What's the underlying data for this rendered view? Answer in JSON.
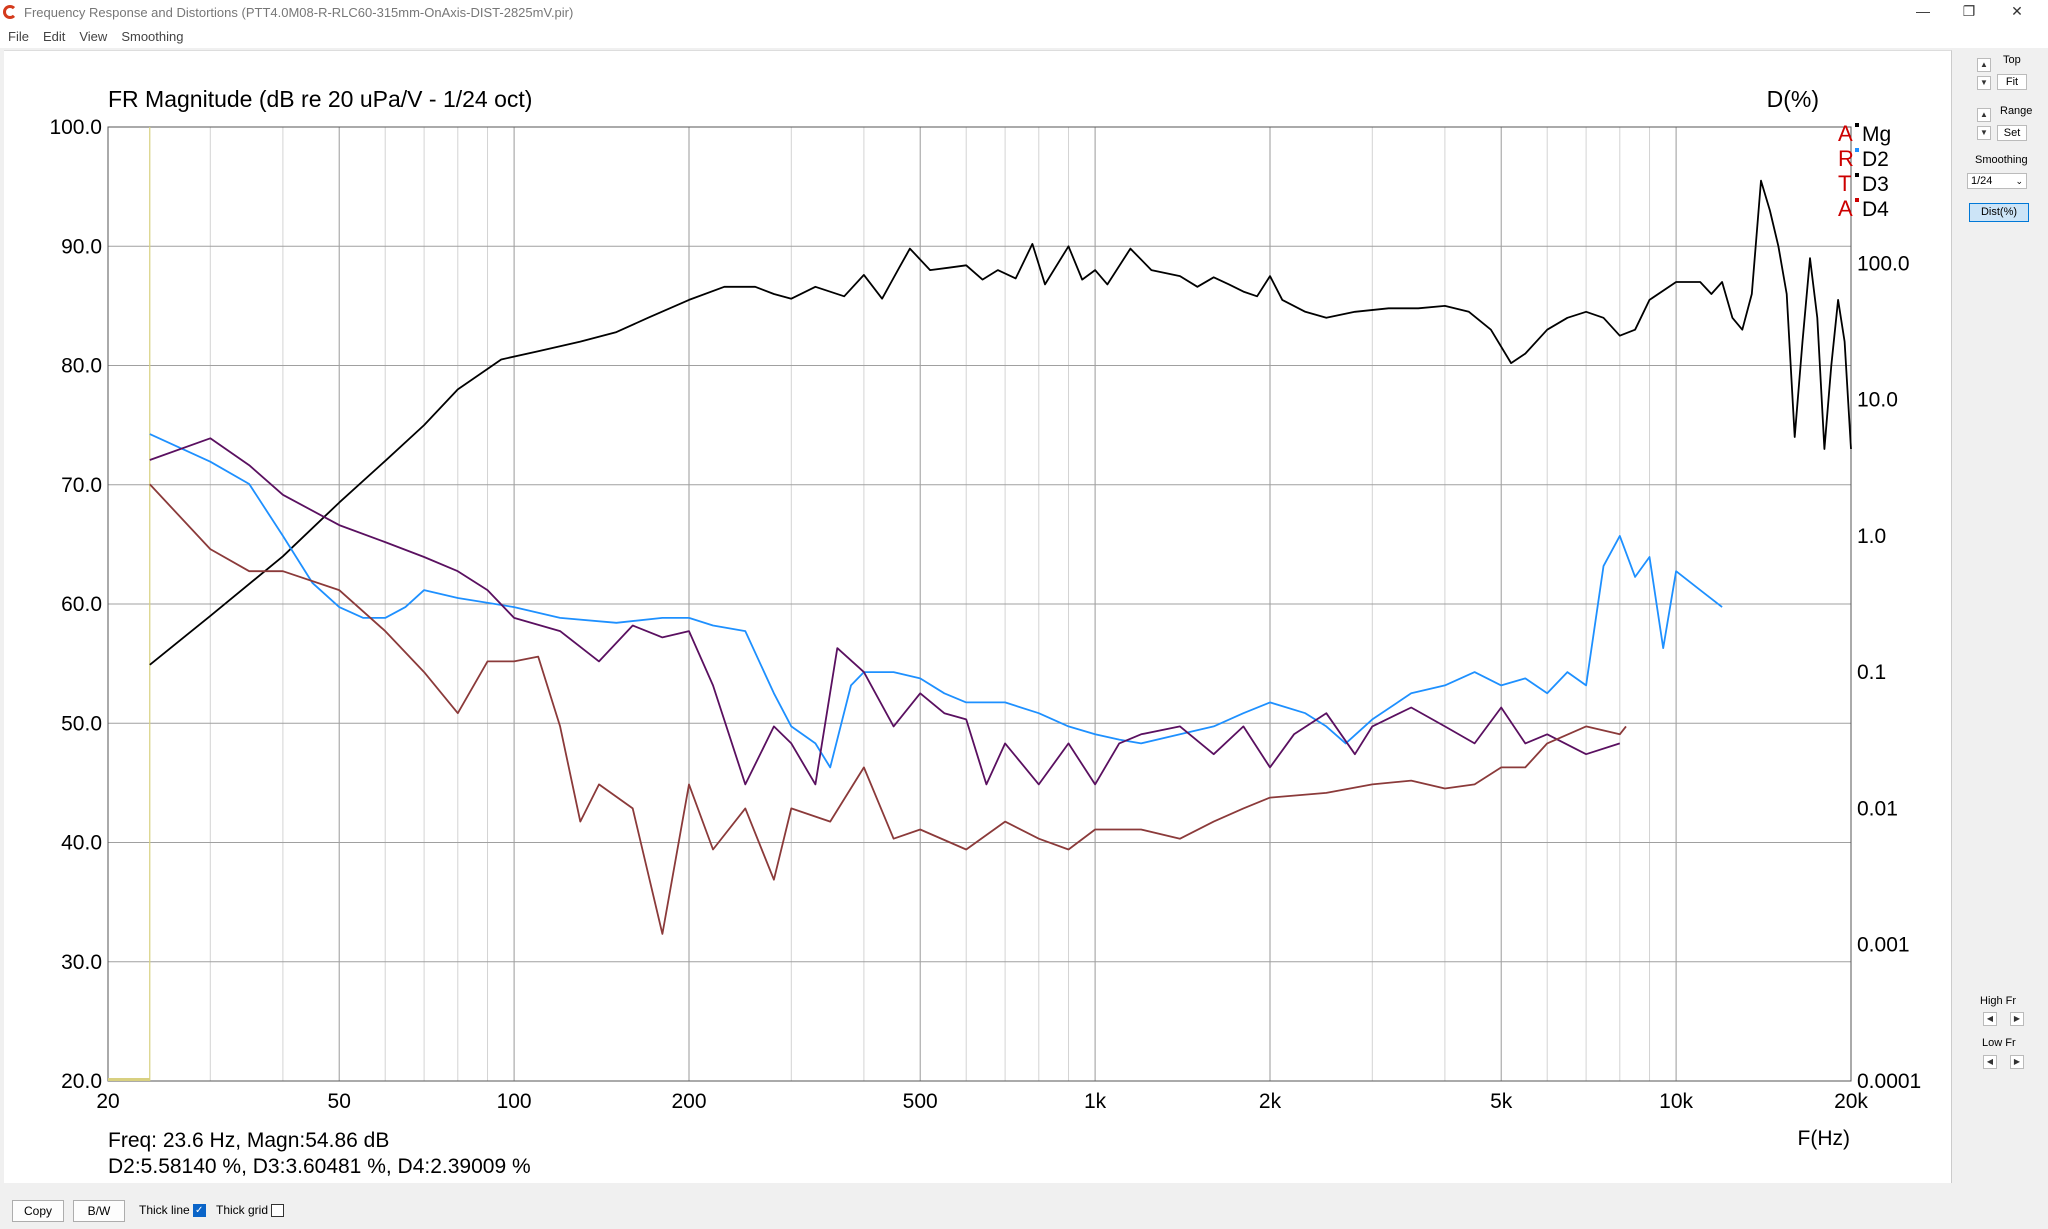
{
  "window": {
    "title": "Frequency Response and Distortions (PTT4.0M08-R-RLC60-315mm-OnAxis-DIST-2825mV.pir)",
    "icon": "app-logo-icon"
  },
  "menu": [
    "File",
    "Edit",
    "View",
    "Smoothing"
  ],
  "side_panel": {
    "top_label": "Top",
    "fit_label": "Fit",
    "range_label": "Range",
    "set_label": "Set",
    "smoothing_label": "Smoothing",
    "smoothing_value": "1/24",
    "dist_button": "Dist(%)",
    "high_fr_label": "High Fr",
    "low_fr_label": "Low Fr"
  },
  "bottom_bar": {
    "copy_label": "Copy",
    "bw_label": "B/W",
    "thick_line_label": "Thick line",
    "thick_line_checked": true,
    "thick_grid_label": "Thick grid",
    "thick_grid_checked": false
  },
  "readout": {
    "line1": "Freq: 23.6 Hz, Magn:54.86 dB",
    "line2": "D2:5.58140 %, D3:3.60481 %, D4:2.39009 %"
  },
  "chart_data": {
    "type": "line",
    "title": "FR Magnitude (dB re 20 uPa/V - 1/24 oct)",
    "right_axis_title": "D(%)",
    "xlabel": "F(Hz)",
    "x_scale": "log",
    "xlim": [
      20,
      20000
    ],
    "ylim": [
      20,
      100
    ],
    "x_ticks": [
      20,
      50,
      100,
      200,
      500,
      1000,
      2000,
      5000,
      10000,
      20000
    ],
    "x_tick_labels": [
      "20",
      "50",
      "100",
      "200",
      "500",
      "1k",
      "2k",
      "5k",
      "10k",
      "20k"
    ],
    "y_ticks": [
      "100.0",
      "90.0",
      "80.0",
      "70.0",
      "60.0",
      "50.0",
      "40.0",
      "30.0",
      "20.0"
    ],
    "y2_scale": "log",
    "y2lim": [
      0.0001,
      1000
    ],
    "y2_ticks": [
      "100.0",
      "10.0",
      "1.0",
      "0.1",
      "0.01",
      "0.001",
      "0.0001"
    ],
    "cursor_freq": 23.6,
    "legend_marks": [
      "A",
      "R",
      "T",
      "A"
    ],
    "legend_colors": [
      "#cc0000",
      "#cc0000",
      "#cc0000",
      "#cc0000"
    ],
    "legend": [
      {
        "name": "Mg",
        "dot": "#000000"
      },
      {
        "name": "D2",
        "dot": "#1e90ff"
      },
      {
        "name": "D3",
        "dot": "#000000"
      },
      {
        "name": "D4",
        "dot": "#cc0000"
      }
    ],
    "series": [
      {
        "name": "Mg",
        "axis": "left",
        "color": "#000000",
        "points": [
          [
            23.6,
            54.9
          ],
          [
            30,
            59
          ],
          [
            40,
            64
          ],
          [
            50,
            68.5
          ],
          [
            60,
            72
          ],
          [
            70,
            75
          ],
          [
            80,
            78
          ],
          [
            95,
            80.5
          ],
          [
            110,
            81.2
          ],
          [
            130,
            82
          ],
          [
            150,
            82.8
          ],
          [
            170,
            84
          ],
          [
            200,
            85.5
          ],
          [
            230,
            86.6
          ],
          [
            260,
            86.6
          ],
          [
            280,
            86
          ],
          [
            300,
            85.6
          ],
          [
            330,
            86.6
          ],
          [
            370,
            85.8
          ],
          [
            400,
            87.6
          ],
          [
            430,
            85.6
          ],
          [
            460,
            88.2
          ],
          [
            480,
            89.8
          ],
          [
            520,
            88
          ],
          [
            560,
            88.2
          ],
          [
            600,
            88.4
          ],
          [
            640,
            87.2
          ],
          [
            680,
            88
          ],
          [
            730,
            87.3
          ],
          [
            780,
            90.2
          ],
          [
            820,
            86.8
          ],
          [
            900,
            90
          ],
          [
            950,
            87.2
          ],
          [
            1000,
            88
          ],
          [
            1050,
            86.8
          ],
          [
            1150,
            89.8
          ],
          [
            1250,
            88
          ],
          [
            1400,
            87.5
          ],
          [
            1500,
            86.6
          ],
          [
            1600,
            87.4
          ],
          [
            1700,
            86.8
          ],
          [
            1800,
            86.2
          ],
          [
            1900,
            85.8
          ],
          [
            2000,
            87.5
          ],
          [
            2100,
            85.5
          ],
          [
            2300,
            84.5
          ],
          [
            2500,
            84
          ],
          [
            2800,
            84.5
          ],
          [
            3200,
            84.8
          ],
          [
            3600,
            84.8
          ],
          [
            4000,
            85
          ],
          [
            4400,
            84.5
          ],
          [
            4800,
            83
          ],
          [
            5200,
            80.2
          ],
          [
            5500,
            81
          ],
          [
            6000,
            83
          ],
          [
            6500,
            84
          ],
          [
            7000,
            84.5
          ],
          [
            7500,
            84
          ],
          [
            8000,
            82.5
          ],
          [
            8500,
            83
          ],
          [
            9000,
            85.5
          ],
          [
            10000,
            87
          ],
          [
            11000,
            87
          ],
          [
            11500,
            86
          ],
          [
            12000,
            87
          ],
          [
            12500,
            84
          ],
          [
            13000,
            83
          ],
          [
            13500,
            86
          ],
          [
            14000,
            95.5
          ],
          [
            14500,
            93
          ],
          [
            15000,
            90
          ],
          [
            15500,
            86
          ],
          [
            16000,
            74
          ],
          [
            16500,
            82
          ],
          [
            17000,
            89
          ],
          [
            17500,
            84
          ],
          [
            18000,
            73
          ],
          [
            18500,
            80
          ],
          [
            19000,
            85.5
          ],
          [
            19500,
            82
          ],
          [
            20000,
            73
          ]
        ]
      },
      {
        "name": "D2",
        "axis": "right",
        "color": "#1e90ff",
        "points": [
          [
            23.6,
            5.58
          ],
          [
            30,
            3.5
          ],
          [
            35,
            2.4
          ],
          [
            40,
            1.0
          ],
          [
            45,
            0.45
          ],
          [
            50,
            0.3
          ],
          [
            55,
            0.25
          ],
          [
            60,
            0.25
          ],
          [
            65,
            0.3
          ],
          [
            70,
            0.4
          ],
          [
            80,
            0.35
          ],
          [
            100,
            0.3
          ],
          [
            120,
            0.25
          ],
          [
            150,
            0.23
          ],
          [
            180,
            0.25
          ],
          [
            200,
            0.25
          ],
          [
            220,
            0.22
          ],
          [
            250,
            0.2
          ],
          [
            280,
            0.07
          ],
          [
            300,
            0.04
          ],
          [
            330,
            0.03
          ],
          [
            350,
            0.02
          ],
          [
            380,
            0.08
          ],
          [
            400,
            0.1
          ],
          [
            450,
            0.1
          ],
          [
            500,
            0.09
          ],
          [
            550,
            0.07
          ],
          [
            600,
            0.06
          ],
          [
            700,
            0.06
          ],
          [
            800,
            0.05
          ],
          [
            900,
            0.04
          ],
          [
            1000,
            0.035
          ],
          [
            1100,
            0.032
          ],
          [
            1200,
            0.03
          ],
          [
            1400,
            0.035
          ],
          [
            1600,
            0.04
          ],
          [
            1800,
            0.05
          ],
          [
            2000,
            0.06
          ],
          [
            2300,
            0.05
          ],
          [
            2500,
            0.04
          ],
          [
            2700,
            0.03
          ],
          [
            3000,
            0.045
          ],
          [
            3500,
            0.07
          ],
          [
            4000,
            0.08
          ],
          [
            4500,
            0.1
          ],
          [
            5000,
            0.08
          ],
          [
            5500,
            0.09
          ],
          [
            6000,
            0.07
          ],
          [
            6500,
            0.1
          ],
          [
            7000,
            0.08
          ],
          [
            7500,
            0.6
          ],
          [
            8000,
            1.0
          ],
          [
            8500,
            0.5
          ],
          [
            9000,
            0.7
          ],
          [
            9500,
            0.15
          ],
          [
            10000,
            0.55
          ],
          [
            11000,
            0.4
          ],
          [
            12000,
            0.3
          ]
        ]
      },
      {
        "name": "D3",
        "axis": "right",
        "color": "#5a1060",
        "points": [
          [
            23.6,
            3.6
          ],
          [
            30,
            5.2
          ],
          [
            35,
            3.3
          ],
          [
            40,
            2.0
          ],
          [
            50,
            1.2
          ],
          [
            60,
            0.9
          ],
          [
            70,
            0.7
          ],
          [
            80,
            0.55
          ],
          [
            90,
            0.4
          ],
          [
            100,
            0.25
          ],
          [
            120,
            0.2
          ],
          [
            140,
            0.12
          ],
          [
            160,
            0.22
          ],
          [
            180,
            0.18
          ],
          [
            200,
            0.2
          ],
          [
            220,
            0.08
          ],
          [
            250,
            0.015
          ],
          [
            280,
            0.04
          ],
          [
            300,
            0.03
          ],
          [
            330,
            0.015
          ],
          [
            360,
            0.15
          ],
          [
            400,
            0.1
          ],
          [
            450,
            0.04
          ],
          [
            500,
            0.07
          ],
          [
            550,
            0.05
          ],
          [
            600,
            0.045
          ],
          [
            650,
            0.015
          ],
          [
            700,
            0.03
          ],
          [
            800,
            0.015
          ],
          [
            900,
            0.03
          ],
          [
            1000,
            0.015
          ],
          [
            1100,
            0.03
          ],
          [
            1200,
            0.035
          ],
          [
            1400,
            0.04
          ],
          [
            1600,
            0.025
          ],
          [
            1800,
            0.04
          ],
          [
            2000,
            0.02
          ],
          [
            2200,
            0.035
          ],
          [
            2500,
            0.05
          ],
          [
            2800,
            0.025
          ],
          [
            3000,
            0.04
          ],
          [
            3500,
            0.055
          ],
          [
            4000,
            0.04
          ],
          [
            4500,
            0.03
          ],
          [
            5000,
            0.055
          ],
          [
            5500,
            0.03
          ],
          [
            6000,
            0.035
          ],
          [
            7000,
            0.025
          ],
          [
            8000,
            0.03
          ]
        ]
      },
      {
        "name": "D4",
        "axis": "right",
        "color": "#8b3a3a",
        "points": [
          [
            23.6,
            2.39
          ],
          [
            30,
            0.8
          ],
          [
            35,
            0.55
          ],
          [
            40,
            0.55
          ],
          [
            50,
            0.4
          ],
          [
            60,
            0.2
          ],
          [
            70,
            0.1
          ],
          [
            80,
            0.05
          ],
          [
            90,
            0.12
          ],
          [
            100,
            0.12
          ],
          [
            110,
            0.13
          ],
          [
            120,
            0.04
          ],
          [
            130,
            0.008
          ],
          [
            140,
            0.015
          ],
          [
            160,
            0.01
          ],
          [
            180,
            0.0012
          ],
          [
            200,
            0.015
          ],
          [
            220,
            0.005
          ],
          [
            250,
            0.01
          ],
          [
            280,
            0.003
          ],
          [
            300,
            0.01
          ],
          [
            350,
            0.008
          ],
          [
            400,
            0.02
          ],
          [
            450,
            0.006
          ],
          [
            500,
            0.007
          ],
          [
            600,
            0.005
          ],
          [
            700,
            0.008
          ],
          [
            800,
            0.006
          ],
          [
            900,
            0.005
          ],
          [
            1000,
            0.007
          ],
          [
            1200,
            0.007
          ],
          [
            1400,
            0.006
          ],
          [
            1600,
            0.008
          ],
          [
            1800,
            0.01
          ],
          [
            2000,
            0.012
          ],
          [
            2500,
            0.013
          ],
          [
            3000,
            0.015
          ],
          [
            3500,
            0.016
          ],
          [
            4000,
            0.014
          ],
          [
            4500,
            0.015
          ],
          [
            5000,
            0.02
          ],
          [
            5500,
            0.02
          ],
          [
            6000,
            0.03
          ],
          [
            7000,
            0.04
          ],
          [
            8000,
            0.035
          ],
          [
            8200,
            0.04
          ]
        ]
      }
    ]
  }
}
